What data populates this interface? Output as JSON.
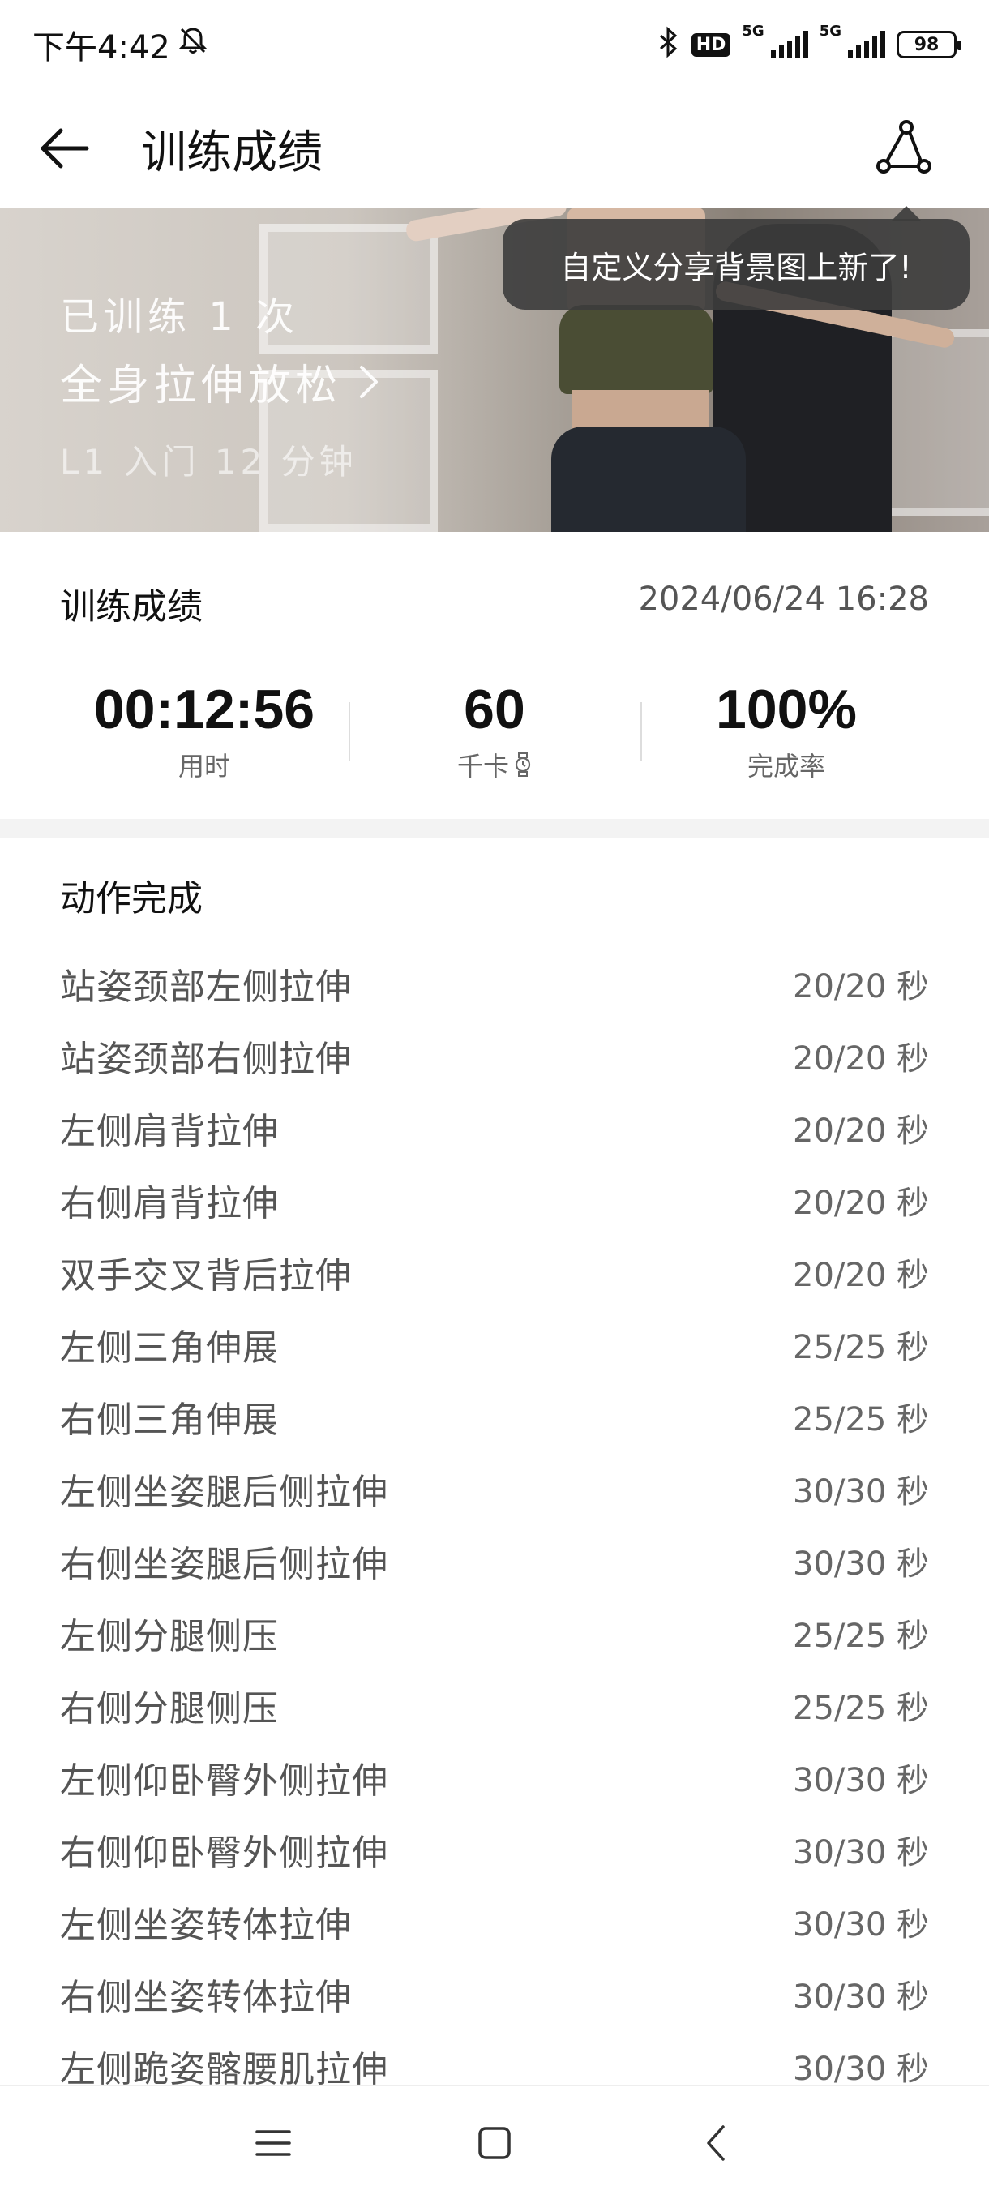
{
  "status_bar": {
    "time": "下午4:42",
    "hd_badge": "HD",
    "net1": "5G",
    "net2": "5G",
    "battery": "98"
  },
  "header": {
    "title": "训练成绩"
  },
  "banner": {
    "trained_times": "已训练 1 次",
    "course_name": "全身拉伸放松",
    "course_meta": "L1 入门  12 分钟",
    "tooltip": "自定义分享背景图上新了!"
  },
  "stats": {
    "section_title": "训练成绩",
    "datetime": "2024/06/24 16:28",
    "duration_value": "00:12:56",
    "duration_label": "用时",
    "calories_value": "60",
    "calories_label": "千卡",
    "completion_value": "100%",
    "completion_label": "完成率"
  },
  "actions": {
    "title": "动作完成",
    "items": [
      {
        "name": "站姿颈部左侧拉伸",
        "time": "20/20 秒"
      },
      {
        "name": "站姿颈部右侧拉伸",
        "time": "20/20 秒"
      },
      {
        "name": "左侧肩背拉伸",
        "time": "20/20 秒"
      },
      {
        "name": "右侧肩背拉伸",
        "time": "20/20 秒"
      },
      {
        "name": "双手交叉背后拉伸",
        "time": "20/20 秒"
      },
      {
        "name": "左侧三角伸展",
        "time": "25/25 秒"
      },
      {
        "name": "右侧三角伸展",
        "time": "25/25 秒"
      },
      {
        "name": "左侧坐姿腿后侧拉伸",
        "time": "30/30 秒"
      },
      {
        "name": "右侧坐姿腿后侧拉伸",
        "time": "30/30 秒"
      },
      {
        "name": "左侧分腿侧压",
        "time": "25/25 秒"
      },
      {
        "name": "右侧分腿侧压",
        "time": "25/25 秒"
      },
      {
        "name": "左侧仰卧臀外侧拉伸",
        "time": "30/30 秒"
      },
      {
        "name": "右侧仰卧臀外侧拉伸",
        "time": "30/30 秒"
      },
      {
        "name": "左侧坐姿转体拉伸",
        "time": "30/30 秒"
      },
      {
        "name": "右侧坐姿转体拉伸",
        "time": "30/30 秒"
      },
      {
        "name": "左侧跪姿髂腰肌拉伸",
        "time": "30/30 秒"
      }
    ]
  },
  "icons": {
    "back": "back-arrow-icon",
    "share": "share-icon",
    "watch": "watch-icon",
    "nav_menu": "menu-icon",
    "nav_home": "home-icon",
    "nav_back": "nav-back-icon"
  }
}
